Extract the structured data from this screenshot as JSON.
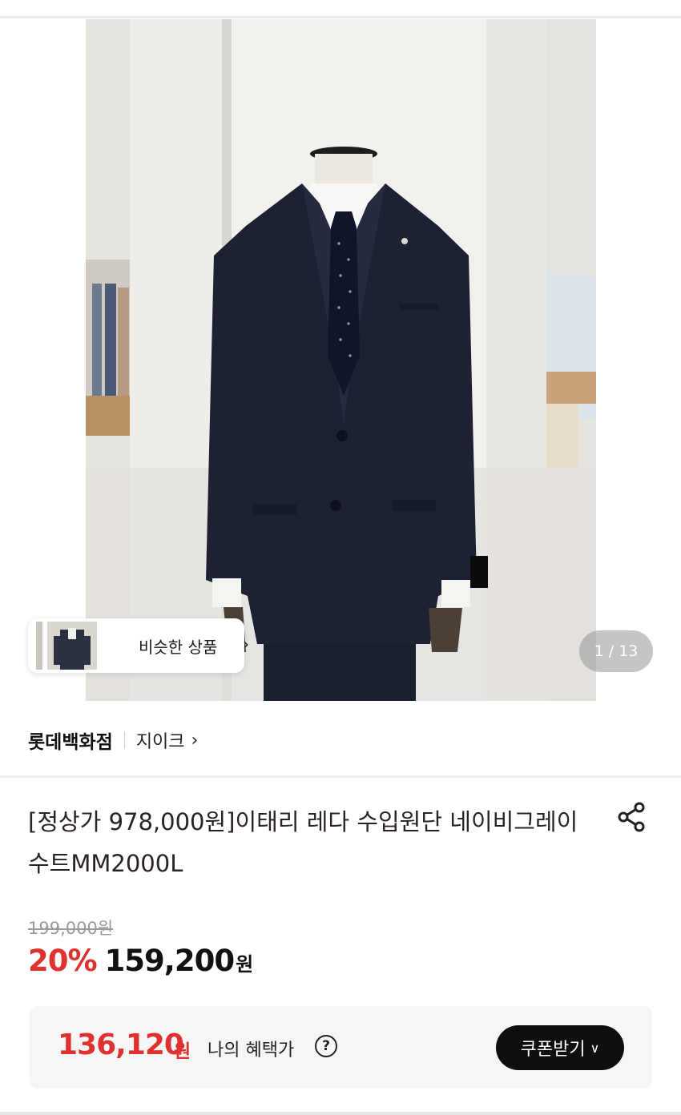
{
  "gallery": {
    "similar_label": "비슷한 상품",
    "counter": "1 / 13"
  },
  "brand": {
    "store": "롯데백화점",
    "name": "지이크"
  },
  "product": {
    "title": "[정상가 978,000원]이태리 레다 수입원단 네이비그레이 수트MM2000L"
  },
  "pricing": {
    "original": "199,000원",
    "discount_rate": "20%",
    "sale_price": "159,200",
    "sale_unit": "원"
  },
  "benefit": {
    "price": "136,120",
    "unit": "원",
    "label": "나의 혜택가",
    "help": "?",
    "coupon_button": "쿠폰받기"
  },
  "colors": {
    "accent_red": "#e03131",
    "button_dark": "#0f0f0f"
  }
}
